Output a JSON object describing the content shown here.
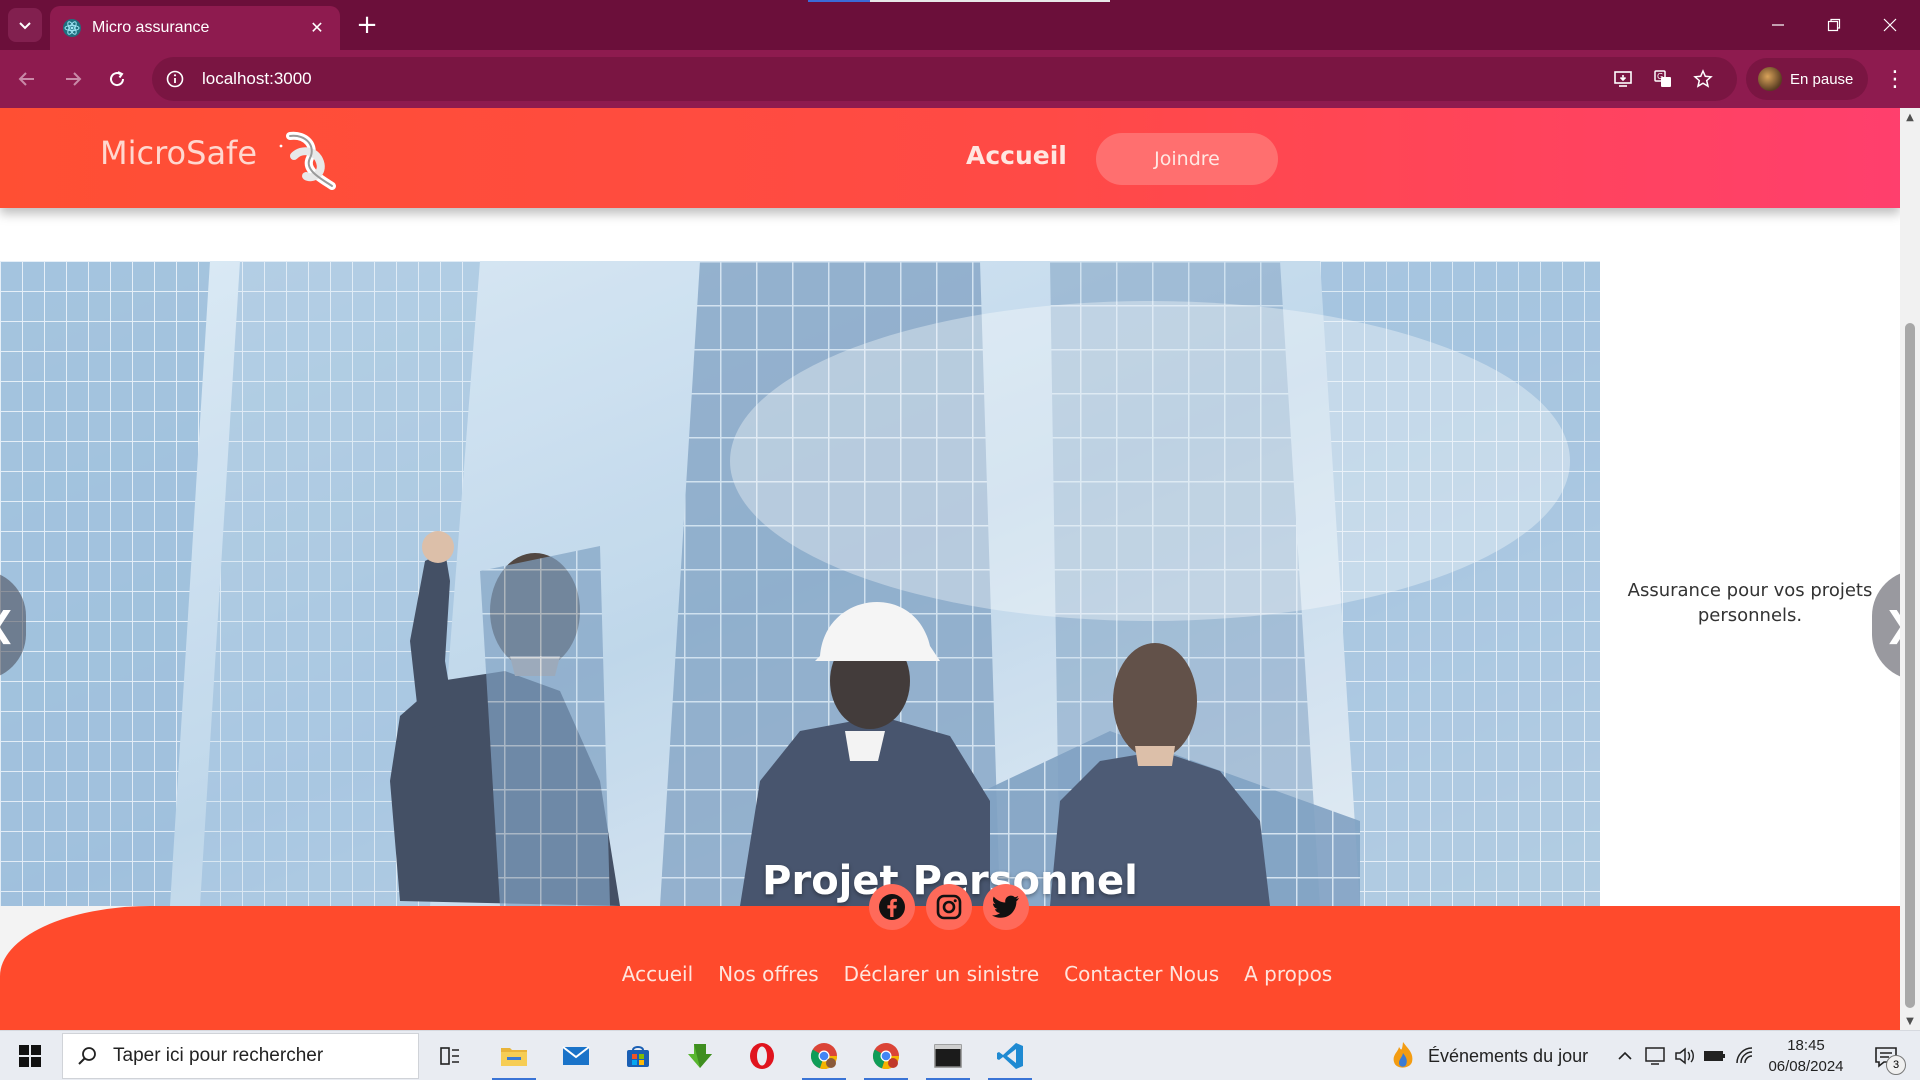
{
  "browser": {
    "tab_title": "Micro assurance",
    "tab_close_glyph": "✕",
    "new_tab_glyph": "+",
    "url": "localhost:3000",
    "profile_label": "En pause",
    "menu_glyph": "⋮"
  },
  "header": {
    "brand": "MicroSafe",
    "nav_home": "Accueil",
    "nav_join": "Joindre"
  },
  "slider": {
    "title": "Projet Personnel",
    "side_text": "Assurance pour vos projets personnels.",
    "prev_glyph": "❮",
    "next_glyph": "❯"
  },
  "footer": {
    "social": [
      "facebook-icon",
      "instagram-icon",
      "twitter-icon"
    ],
    "links": [
      "Accueil",
      "Nos offres",
      "Déclarer un sinistre",
      "Contacter Nous",
      "A propos"
    ]
  },
  "taskbar": {
    "search_placeholder": "Taper ici pour rechercher",
    "news_label": "Événements du jour",
    "time": "18:45",
    "date": "06/08/2024",
    "notification_count": "3"
  },
  "colors": {
    "browser_frame": "#6b0f3a",
    "browser_toolbar": "#8e1b4f",
    "header_start": "#ff4f33",
    "header_end": "#ff3f6d",
    "join_button": "#ff6f6f",
    "footer": "#ff4a2c"
  }
}
